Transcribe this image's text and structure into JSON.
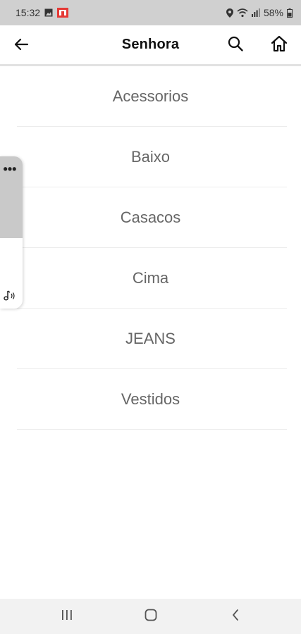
{
  "status_bar": {
    "time": "15:32",
    "battery": "58%"
  },
  "app_bar": {
    "title": "Senhora"
  },
  "categories": [
    {
      "label": "Acessorios"
    },
    {
      "label": "Baixo"
    },
    {
      "label": "Casacos"
    },
    {
      "label": "Cima"
    },
    {
      "label": "JEANS"
    },
    {
      "label": "Vestidos"
    }
  ],
  "side_widget": {
    "more_label": "•••"
  },
  "icons": {
    "back": "arrow-left-icon",
    "search": "search-icon",
    "home": "home-icon",
    "recents": "recent-apps-icon",
    "nav_home": "nav-home-icon",
    "nav_back": "nav-back-icon"
  },
  "colors": {
    "status_bar_bg": "#d0d0d0",
    "category_text": "#666666",
    "divider": "#ececec",
    "nav_bar_bg": "#f2f2f2"
  }
}
